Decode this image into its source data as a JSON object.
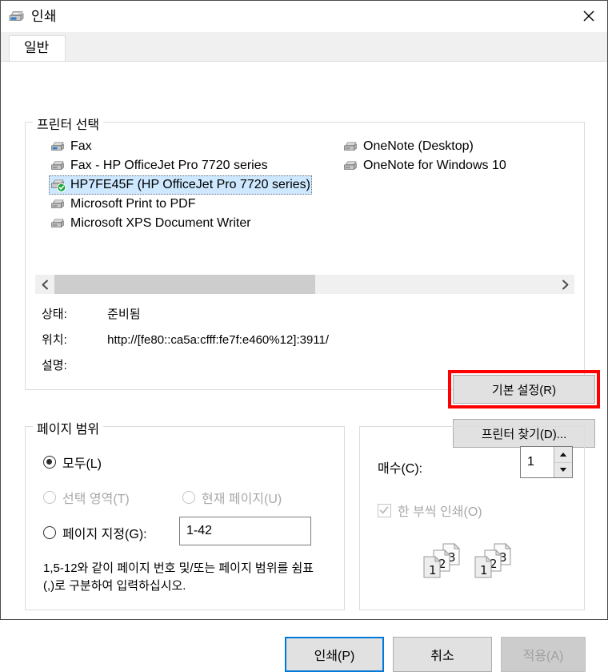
{
  "window": {
    "title": "인쇄",
    "icon": "printer-icon",
    "close_icon": "close-icon"
  },
  "tabs": [
    {
      "label": "일반",
      "active": true
    }
  ],
  "printer_group": {
    "title": "프린터 선택",
    "printers_left": [
      {
        "name": "Fax",
        "selected": false,
        "default": false
      },
      {
        "name": "Fax - HP OfficeJet Pro 7720 series",
        "selected": false,
        "default": false
      },
      {
        "name": "HP7FE45F (HP OfficeJet Pro 7720 series)",
        "selected": true,
        "default": true
      },
      {
        "name": "Microsoft Print to PDF",
        "selected": false,
        "default": false
      },
      {
        "name": "Microsoft XPS Document Writer",
        "selected": false,
        "default": false
      }
    ],
    "printers_right": [
      {
        "name": "OneNote (Desktop)",
        "selected": false,
        "default": false
      },
      {
        "name": "OneNote for Windows 10",
        "selected": false,
        "default": false
      }
    ],
    "scrollbar": {
      "left_arrow_icon": "chevron-left-icon",
      "right_arrow_icon": "chevron-right-icon"
    },
    "status": {
      "status_label": "상태:",
      "status_value": "준비됨",
      "location_label": "위치:",
      "location_value": "http://[fe80::ca5a:cfff:fe7f:e460%12]:3911/",
      "comment_label": "설명:",
      "comment_value": ""
    },
    "preferences_button": "기본 설정(R)",
    "find_printer_button": "프린터 찾기(D)..."
  },
  "page_range": {
    "title": "페이지 범위",
    "options": [
      {
        "label": "모두(L)",
        "checked": true,
        "disabled": false
      },
      {
        "label": "선택 영역(T)",
        "checked": false,
        "disabled": true
      },
      {
        "label": "현재 페이지(U)",
        "checked": false,
        "disabled": true
      },
      {
        "label": "페이지 지정(G):",
        "checked": false,
        "disabled": false
      }
    ],
    "pages_value": "1-42",
    "help_text": "1,5-12와 같이 페이지 번호 및/또는 페이지 범위를 쉼표(,)로 구분하여 입력하십시오."
  },
  "copies": {
    "copies_label": "매수(C):",
    "copies_value": "1",
    "spin_up_icon": "arrow-up-icon",
    "spin_down_icon": "arrow-down-icon",
    "collate_label": "한 부씩 인쇄(O)",
    "collate_checked": true,
    "collate_disabled": true,
    "collate_page_numbers": [
      "1",
      "2",
      "3"
    ]
  },
  "footer": {
    "print_button": "인쇄(P)",
    "cancel_button": "취소",
    "apply_button": "적용(A)"
  },
  "annotation": {
    "target": "preferences-button",
    "color": "#ff0000"
  },
  "colors": {
    "selection_blue": "#cde8ff",
    "focus_blue": "#0078d7",
    "default_badge_green": "#17a437",
    "annotation_red": "#ff0000",
    "window_bg": "#f0f0f0"
  }
}
